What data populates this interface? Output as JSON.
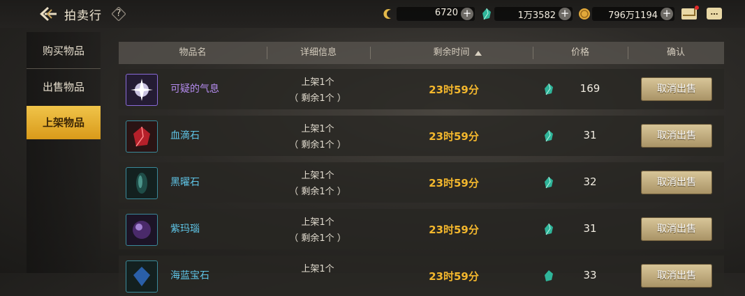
{
  "header": {
    "title": "拍卖行",
    "help": "?",
    "currencies": [
      {
        "icon": "moon-coin-icon",
        "value": "6720"
      },
      {
        "icon": "green-gem-icon",
        "value": "1万3582"
      },
      {
        "icon": "gold-coin-icon",
        "value": "796万1194"
      }
    ],
    "plus": "+",
    "chat_glyph": "…"
  },
  "tabs": [
    {
      "label": "购买物品",
      "active": false
    },
    {
      "label": "出售物品",
      "active": false
    },
    {
      "label": "上架物品",
      "active": true
    }
  ],
  "table": {
    "columns": [
      "物品名",
      "详细信息",
      "剩余时间",
      "价格",
      "确认"
    ],
    "rows": [
      {
        "name": "可疑的气息",
        "name_color": "#b58cf0",
        "icon": "mystic-aura-icon",
        "detail1": "上架1个",
        "detail2": "（ 剩余1个 ）",
        "time": "23时59分",
        "price": "169",
        "action": "取消出售"
      },
      {
        "name": "血滴石",
        "name_color": "#5fc6e8",
        "icon": "blood-stone-icon",
        "detail1": "上架1个",
        "detail2": "（ 剩余1个 ）",
        "time": "23时59分",
        "price": "31",
        "action": "取消出售"
      },
      {
        "name": "黑曜石",
        "name_color": "#5fc6e8",
        "icon": "obsidian-icon",
        "detail1": "上架1个",
        "detail2": "（ 剩余1个 ）",
        "time": "23时59分",
        "price": "32",
        "action": "取消出售"
      },
      {
        "name": "紫玛瑙",
        "name_color": "#5fc6e8",
        "icon": "purple-agate-icon",
        "detail1": "上架1个",
        "detail2": "（ 剩余1个 ）",
        "time": "23时59分",
        "price": "31",
        "action": "取消出售"
      },
      {
        "name": "海蓝宝石",
        "name_color": "#5fc6e8",
        "icon": "aquamarine-icon",
        "detail1": "上架1个",
        "detail2": "",
        "time": "23时59分",
        "price": "33",
        "action": "取消出售"
      }
    ]
  },
  "colors": {
    "accent": "#f3b72d",
    "tab_active": "#e6ad2c"
  }
}
